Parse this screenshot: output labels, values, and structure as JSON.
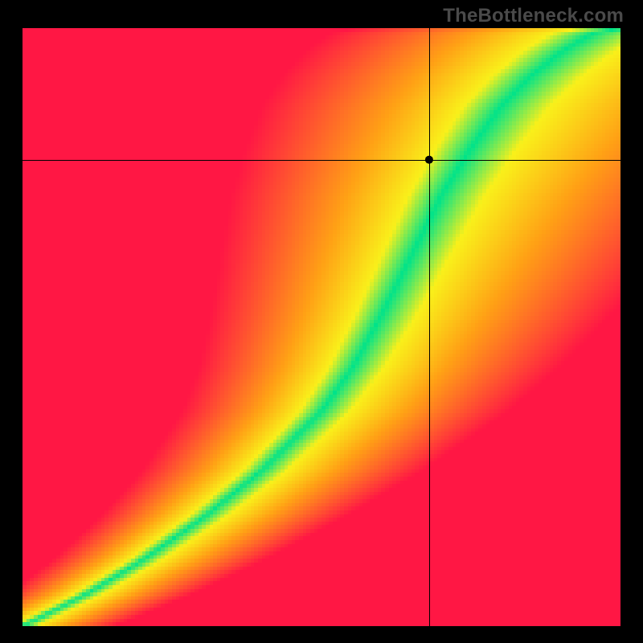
{
  "watermark": "TheBottleneck.com",
  "chart_data": {
    "type": "heatmap",
    "title": "",
    "xlabel": "",
    "ylabel": "",
    "xlim": [
      0,
      1
    ],
    "ylim": [
      0,
      1
    ],
    "xticks": [],
    "yticks": [],
    "legend": false,
    "grid": false,
    "crosshair": {
      "x": 0.68,
      "y": 0.78
    },
    "marker": {
      "x": 0.68,
      "y": 0.78,
      "radius": 5
    },
    "resolution": 160,
    "optimal_curve_anchors": [
      [
        0.0,
        0.0
      ],
      [
        0.1,
        0.05
      ],
      [
        0.2,
        0.11
      ],
      [
        0.3,
        0.18
      ],
      [
        0.4,
        0.26
      ],
      [
        0.5,
        0.36
      ],
      [
        0.55,
        0.43
      ],
      [
        0.6,
        0.52
      ],
      [
        0.65,
        0.62
      ],
      [
        0.7,
        0.72
      ],
      [
        0.75,
        0.8
      ],
      [
        0.8,
        0.87
      ],
      [
        0.85,
        0.92
      ],
      [
        0.9,
        0.96
      ],
      [
        0.95,
        0.99
      ],
      [
        1.0,
        1.0
      ]
    ],
    "band_halfwidth_x": 0.055,
    "colors": {
      "green": "#00e38a",
      "yellow": "#f9f01a",
      "orange": "#ffa015",
      "red": "#ff1744"
    },
    "gradient_stops": [
      {
        "d": 0.0,
        "r": 0,
        "g": 227,
        "b": 138
      },
      {
        "d": 0.15,
        "r": 249,
        "g": 240,
        "b": 26
      },
      {
        "d": 0.45,
        "r": 255,
        "g": 160,
        "b": 21
      },
      {
        "d": 1.0,
        "r": 255,
        "g": 23,
        "b": 68
      }
    ]
  }
}
